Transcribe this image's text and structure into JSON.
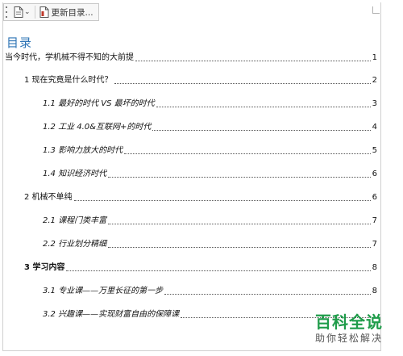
{
  "toolbar": {
    "update_label": "更新目录...",
    "icons": [
      "drag-handle",
      "document-icon",
      "chevron-down-icon",
      "update-document-icon"
    ]
  },
  "toc": {
    "heading": "目录",
    "entries": [
      {
        "title": "当今时代，学机械不得不知的大前提",
        "page": "1",
        "level": 0,
        "bold": false
      },
      {
        "title": "1 现在究竟是什么时代？",
        "page": "2",
        "level": 1,
        "bold": false
      },
      {
        "title": "1.1 最好的时代 VS 最坏的时代",
        "page": "3",
        "level": 2,
        "bold": false
      },
      {
        "title": "1.2 工业 4.0&互联网+的时代",
        "page": "4",
        "level": 2,
        "bold": false
      },
      {
        "title": "1.3 影响力放大的时代",
        "page": "5",
        "level": 2,
        "bold": false
      },
      {
        "title": "1.4 知识经济时代",
        "page": "6",
        "level": 2,
        "bold": false
      },
      {
        "title": "2 机械不单纯",
        "page": "6",
        "level": 1,
        "bold": false
      },
      {
        "title": "2.1 课程门类丰富",
        "page": "7",
        "level": 2,
        "bold": false
      },
      {
        "title": "2.2 行业划分精细",
        "page": "7",
        "level": 2,
        "bold": false
      },
      {
        "title": "3 学习内容",
        "page": "8",
        "level": 1,
        "bold": true
      },
      {
        "title": "3.1 专业课——万里长征的第一步",
        "page": "8",
        "level": 2,
        "bold": false
      },
      {
        "title": "3.2 兴趣课——实现财富自由的保障课",
        "page": "",
        "level": 2,
        "bold": false
      }
    ]
  },
  "watermark": {
    "main": "百科全说",
    "sub": "助你轻松解决"
  },
  "colors": {
    "heading": "#2e74b5",
    "watermark": "#1f9c4a"
  }
}
